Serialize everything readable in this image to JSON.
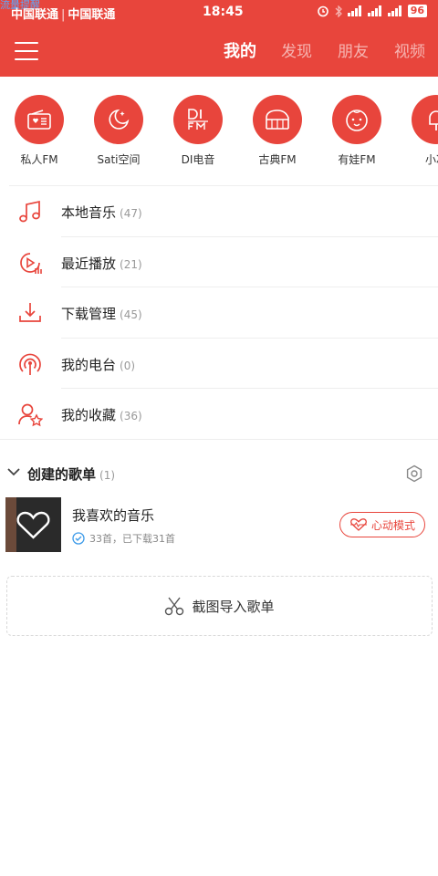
{
  "status_bar": {
    "watermark": "流量提醒",
    "carrier1": "中国联通",
    "carrier2": "中国联通",
    "time": "18:45",
    "battery": "96"
  },
  "nav": {
    "tabs": [
      {
        "label": "我的",
        "active": true
      },
      {
        "label": "发现",
        "active": false
      },
      {
        "label": "朋友",
        "active": false
      },
      {
        "label": "视频",
        "active": false
      }
    ]
  },
  "channels": [
    {
      "label": "私人FM",
      "icon": "radio-icon"
    },
    {
      "label": "Sati空间",
      "icon": "moon-icon"
    },
    {
      "label": "DI电音",
      "icon": "di-fm-icon"
    },
    {
      "label": "古典FM",
      "icon": "piano-icon"
    },
    {
      "label": "有娃FM",
      "icon": "baby-face-icon"
    },
    {
      "label": "小冰",
      "icon": "ice-cream-icon"
    }
  ],
  "menu": [
    {
      "label": "本地音乐",
      "count": "(47)",
      "icon": "music-note-icon"
    },
    {
      "label": "最近播放",
      "count": "(21)",
      "icon": "recent-play-icon"
    },
    {
      "label": "下载管理",
      "count": "(45)",
      "icon": "download-icon"
    },
    {
      "label": "我的电台",
      "count": "(0)",
      "icon": "radio-station-icon"
    },
    {
      "label": "我的收藏",
      "count": "(36)",
      "icon": "user-star-icon"
    }
  ],
  "created_section": {
    "title": "创建的歌单",
    "count": "(1)"
  },
  "playlist": {
    "title": "我喜欢的音乐",
    "subtitle": "33首，已下载31首",
    "mode_button": "心动模式"
  },
  "import": {
    "label": "截图导入歌单"
  },
  "colors": {
    "brand": "#e8453c",
    "divider": "#eeeeee",
    "count_text": "#999999"
  }
}
